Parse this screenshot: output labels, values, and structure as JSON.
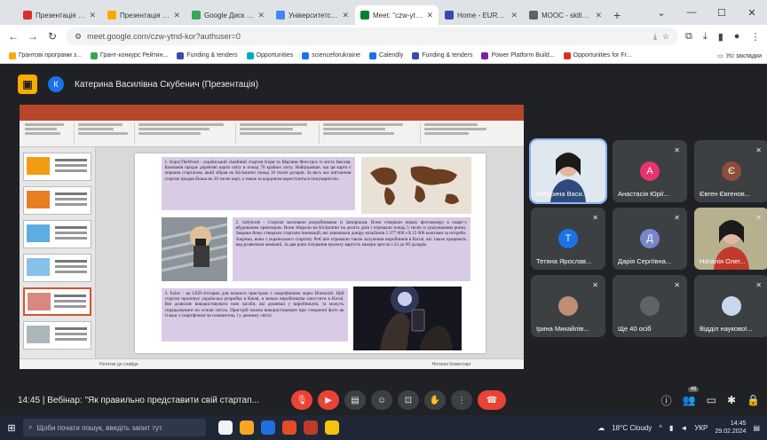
{
  "browser": {
    "tabs": [
      {
        "label": "Презентація Skills21",
        "color": "#d93025",
        "active": false
      },
      {
        "label": "Презентація Skills21",
        "color": "#f9ab00",
        "active": false
      },
      {
        "label": "Google Диск - папк",
        "color": "#34a853",
        "active": false
      },
      {
        "label": "Університетський",
        "color": "#4285f4",
        "active": false
      },
      {
        "label": "Meet: \"czw-ytnd-",
        "color": "#00832d",
        "active": true
      },
      {
        "label": "Home - EUROPEAN",
        "color": "#3949ab",
        "active": false
      },
      {
        "label": "MOOC - skills2com",
        "color": "#5f6368",
        "active": false
      }
    ],
    "url": "meet.google.com/czw-ytnd-kor?authuser=0",
    "bookmarks": [
      {
        "label": "Грантові програми з...",
        "color": "#f9ab00"
      },
      {
        "label": "Грант-конкурс Рейтин...",
        "color": "#34a853"
      },
      {
        "label": "Funding & tenders",
        "color": "#3949ab"
      },
      {
        "label": "Opportunities",
        "color": "#00acc1"
      },
      {
        "label": "scienceforukraine",
        "color": "#1a73e8"
      },
      {
        "label": "Calendly",
        "color": "#1a73e8"
      },
      {
        "label": "Funding & tenders",
        "color": "#3949ab"
      },
      {
        "label": "Power Platform Build...",
        "color": "#7b1fa2"
      },
      {
        "label": "Opportunities for Fr...",
        "color": "#d93025"
      }
    ],
    "bookmarks_all": "Усі закладки"
  },
  "meet": {
    "presenter": "Катерина Василівна Скубенич (Презентація)",
    "presenter_initial": "К",
    "participants": [
      {
        "name": "Катерина Васи...",
        "initial": "",
        "color": "#ffffff",
        "video": true
      },
      {
        "name": "Анастасія Юрії...",
        "initial": "А",
        "color": "#e8336d",
        "video": false
      },
      {
        "name": "Євген Євгенов...",
        "initial": "Є",
        "color": "#8d4e3a",
        "video": false
      },
      {
        "name": "Тетяна Ярослав...",
        "initial": "Т",
        "color": "#1a73e8",
        "video": false
      },
      {
        "name": "Дарія Сергіївна...",
        "initial": "Д",
        "color": "#7986cb",
        "video": false
      },
      {
        "name": "Наталія Олег...",
        "initial": "",
        "color": "#ffffff",
        "video": true
      },
      {
        "name": "Ірина Михайлів...",
        "initial": "",
        "color": "#c08e73",
        "video": false
      },
      {
        "name": "Ще 40 осіб",
        "initial": "",
        "color": "#5f6368",
        "video": false
      },
      {
        "name": "Відділ наукової...",
        "initial": "",
        "color": "#c5d8ec",
        "video": false
      }
    ],
    "time": "14:45",
    "meeting_title": "Вебінар: \"Як правильно представити свій стартап...",
    "participants_count": "49"
  },
  "slide": {
    "text1": "1. EnjoyTheWood - український сімейний стартап Ігоря та Мар'яни Феєстрос із міста Ізяслав. Компанія продає дерев'яні карти світу в понад 70 країнах світу. Найцікавіше, що ця карта є першим стартапом, який зібрав на Kickstarter понад 10 тисяч доларів. За весь час натхнення стартап продав більш як 20 тисяч карт, а також за кордоном користуються популярністю.",
    "text2": "2. Jollybook - Стартап засновано розробниками із Запоріжжя. Вони створили першу фотокамеру в смарт-з вбудованим принтером. Вони збирали на Kickstarter на десять днів і отримали понад 5 тисяч із урахуванням ринку. Завдяки йому створили стартапи інновацій, які завоювали довіру мільйонів 5 377 000 з $ 15 000 коштами за потреби. Зокрема, вони з українського стартапу PetCube отримали також залучення виробників в Китаї, які також працюють над розвитком компанії. За два роки існування проекту вартість камери зросла з 23 до 69 доларів.",
    "text3": "3. Ezloc - це LED-ліхтарик для кожного пристрою з смартфонами через Bluetooth. Цей стартап пропонує українська розробка в Києві, в межах виробництва запустити в Китаї. Він дозволяє використовувати нові засоби, які дешевші у виробництві, та можуть спрацьовувати на основі світла. Пристрій можна використовувати при створенні фото як тільки з смартфоном чи планшетом, і у денному світлі.",
    "notes": "Нотатки до слайда",
    "status": "Нотатки  Коментарі"
  },
  "taskbar": {
    "search_placeholder": "Щоби почати пошук, введіть запит тут",
    "weather": "18°C Cloudy",
    "lang": "УКР",
    "time": "14:45",
    "date": "29.02.2024"
  }
}
